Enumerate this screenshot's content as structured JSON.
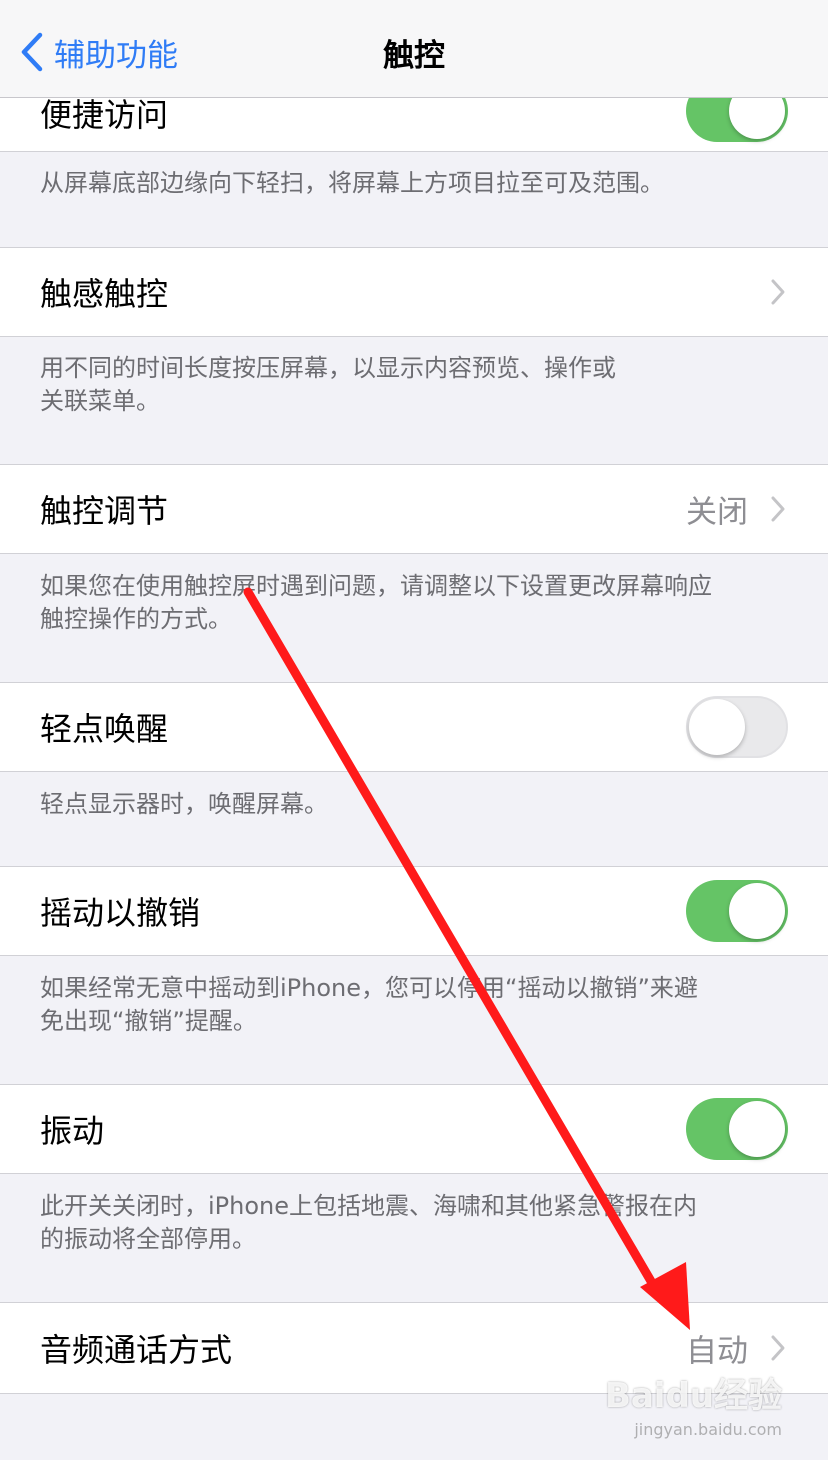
{
  "nav": {
    "back_label": "辅助功能",
    "title": "触控"
  },
  "sections": [
    {
      "label": "便捷访问",
      "control": "toggle",
      "on": true,
      "footer": "从屏幕底部边缘向下轻扫，将屏幕上方项目拉至可及范围。"
    },
    {
      "label": "触感触控",
      "control": "chevron",
      "footer": "用不同的时间长度按压屏幕，以显示内容预览、操作或\n关联菜单。"
    },
    {
      "label": "触控调节",
      "control": "chevron",
      "value": "关闭",
      "footer": "如果您在使用触控屏时遇到问题，请调整以下设置更改屏幕响应\n触控操作的方式。"
    },
    {
      "label": "轻点唤醒",
      "control": "toggle",
      "on": false,
      "footer": "轻点显示器时，唤醒屏幕。"
    },
    {
      "label": "摇动以撤销",
      "control": "toggle",
      "on": true,
      "footer": "如果经常无意中摇动到iPhone，您可以停用“摇动以撤销”来避\n免出现“撤销”提醒。"
    },
    {
      "label": "振动",
      "control": "toggle",
      "on": true,
      "footer": "此开关关闭时，iPhone上包括地震、海啸和其他紧急警报在内\n的振动将全部停用。"
    },
    {
      "label": "音频通话方式",
      "control": "chevron",
      "value": "自动"
    }
  ],
  "colors": {
    "accent_blue": "#2f7cf6",
    "toggle_on": "#65c466",
    "annotation_arrow": "#ff1a1a"
  },
  "watermark": {
    "brand": "Baidu经验",
    "url": "jingyan.baidu.com"
  }
}
